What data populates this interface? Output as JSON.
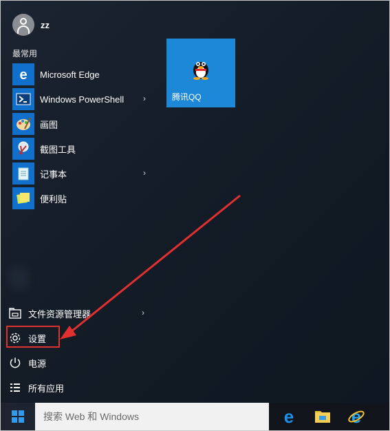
{
  "user": {
    "name": "zz",
    "icon": "user-avatar-icon"
  },
  "section": {
    "most_used": "最常用"
  },
  "apps": [
    {
      "label": "Microsoft Edge",
      "icon": "edge-icon",
      "has_submenu": false
    },
    {
      "label": "Windows PowerShell",
      "icon": "powershell-icon",
      "has_submenu": true
    },
    {
      "label": "画图",
      "icon": "paint-icon",
      "has_submenu": false
    },
    {
      "label": "截图工具",
      "icon": "snipping-tool-icon",
      "has_submenu": false
    },
    {
      "label": "记事本",
      "icon": "notepad-icon",
      "has_submenu": true
    },
    {
      "label": "便利贴",
      "icon": "sticky-notes-icon",
      "has_submenu": false
    }
  ],
  "tiles": [
    {
      "label": "腾讯QQ",
      "icon": "qq-penguin-icon",
      "color": "#1e88d8"
    }
  ],
  "bottom": [
    {
      "label": "文件资源管理器",
      "icon": "file-explorer-icon",
      "has_submenu": true
    },
    {
      "label": "设置",
      "icon": "gear-icon",
      "has_submenu": false
    },
    {
      "label": "电源",
      "icon": "power-icon",
      "has_submenu": false
    },
    {
      "label": "所有应用",
      "icon": "all-apps-icon",
      "has_submenu": false
    }
  ],
  "taskbar": {
    "search_placeholder": "搜索 Web 和 Windows",
    "pinned": [
      "edge-icon",
      "file-explorer-icon",
      "internet-explorer-icon"
    ]
  },
  "colors": {
    "tile_blue": "#1070cc",
    "highlight": "#e03030",
    "qq_tile": "#1e88d8"
  }
}
